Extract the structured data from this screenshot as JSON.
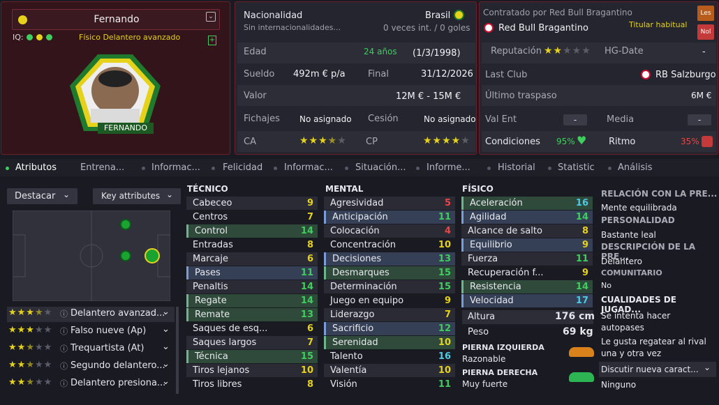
{
  "player": {
    "name": "Fernando",
    "iq_label": "IQ:",
    "role": "Físico  Delantero avanzado",
    "tag": "FERNANDO"
  },
  "info": {
    "nationality_label": "Nacionalidad",
    "nationality": "Brasil",
    "intl_label": "Sin internacionalidades...",
    "intl_value": "0 veces int. / 0 goles",
    "age_label": "Edad",
    "age": "24 años",
    "dob": "(1/3/1998)",
    "wage_label": "Sueldo",
    "wage": "492m € p/a",
    "end_label": "Final",
    "end": "31/12/2026",
    "value_label": "Valor",
    "value": "12M € - 15M €",
    "transfers_label": "Fichajes",
    "transfers": "No asignado",
    "loan_label": "Cesión",
    "loan": "No asignado",
    "ca_label": "CA",
    "cp_label": "CP",
    "ca_stars": 3.5,
    "cp_stars": 4
  },
  "club": {
    "contract_label": "Contratado por Red Bull Bragantino",
    "club_name": "Red Bull Bragantino",
    "status": "Titular habitual",
    "les": "Les",
    "nol": "Nol",
    "reputation_label": "Reputación",
    "reputation_stars": 2,
    "hg_label": "HG-Date",
    "hg_value": "-",
    "last_club_label": "Last Club",
    "last_club": "RB Salzburgo",
    "last_transfer_label": "Último traspaso",
    "last_transfer": "6M €",
    "val_ent_label": "Val Ent",
    "val_ent": "-",
    "media_label": "Media",
    "media": "-",
    "cond_label": "Condiciones",
    "cond": "95%",
    "rhythm_label": "Ritmo",
    "rhythm": "35%"
  },
  "tabs": [
    "Atributos",
    "Entrena...",
    "Informac...",
    "Felicidad",
    "Informac...",
    "Situación...",
    "Informe...",
    "Historial",
    "Statistic",
    "Análisis"
  ],
  "controls": {
    "highlight": "Destacar",
    "key": "Key attributes"
  },
  "technical": {
    "title": "TÉCNICO",
    "rows": [
      {
        "name": "Cabeceo",
        "value": "9",
        "hl": ""
      },
      {
        "name": "Centros",
        "value": "7",
        "hl": ""
      },
      {
        "name": "Control",
        "value": "14",
        "hl": "g"
      },
      {
        "name": "Entradas",
        "value": "8",
        "hl": ""
      },
      {
        "name": "Marcaje",
        "value": "6",
        "hl": ""
      },
      {
        "name": "Pases",
        "value": "11",
        "hl": "b"
      },
      {
        "name": "Penaltis",
        "value": "14",
        "hl": ""
      },
      {
        "name": "Regate",
        "value": "14",
        "hl": "g"
      },
      {
        "name": "Remate",
        "value": "13",
        "hl": "g"
      },
      {
        "name": "Saques de esq...",
        "value": "6",
        "hl": ""
      },
      {
        "name": "Saques largos",
        "value": "7",
        "hl": ""
      },
      {
        "name": "Técnica",
        "value": "15",
        "hl": "g"
      },
      {
        "name": "Tiros lejanos",
        "value": "10",
        "hl": ""
      },
      {
        "name": "Tiros libres",
        "value": "8",
        "hl": ""
      }
    ]
  },
  "mental": {
    "title": "MENTAL",
    "rows": [
      {
        "name": "Agresividad",
        "value": "5",
        "hl": ""
      },
      {
        "name": "Anticipación",
        "value": "11",
        "hl": "b"
      },
      {
        "name": "Colocación",
        "value": "4",
        "hl": ""
      },
      {
        "name": "Concentración",
        "value": "10",
        "hl": ""
      },
      {
        "name": "Decisiones",
        "value": "13",
        "hl": "b"
      },
      {
        "name": "Desmarques",
        "value": "15",
        "hl": "g"
      },
      {
        "name": "Determinación",
        "value": "15",
        "hl": ""
      },
      {
        "name": "Juego en equipo",
        "value": "9",
        "hl": ""
      },
      {
        "name": "Liderazgo",
        "value": "7",
        "hl": ""
      },
      {
        "name": "Sacrificio",
        "value": "12",
        "hl": "b"
      },
      {
        "name": "Serenidad",
        "value": "10",
        "hl": "g"
      },
      {
        "name": "Talento",
        "value": "16",
        "hl": ""
      },
      {
        "name": "Valentía",
        "value": "10",
        "hl": ""
      },
      {
        "name": "Visión",
        "value": "11",
        "hl": ""
      }
    ]
  },
  "physical": {
    "title": "FÍSICO",
    "rows": [
      {
        "name": "Aceleración",
        "value": "16",
        "hl": "g"
      },
      {
        "name": "Agilidad",
        "value": "14",
        "hl": "b"
      },
      {
        "name": "Alcance de salto",
        "value": "8",
        "hl": ""
      },
      {
        "name": "Equilibrio",
        "value": "9",
        "hl": "b"
      },
      {
        "name": "Fuerza",
        "value": "11",
        "hl": ""
      },
      {
        "name": "Recuperación f...",
        "value": "9",
        "hl": ""
      },
      {
        "name": "Resistencia",
        "value": "14",
        "hl": "g"
      },
      {
        "name": "Velocidad",
        "value": "17",
        "hl": "b"
      }
    ],
    "height_label": "Altura",
    "height": "176 cm",
    "weight_label": "Peso",
    "weight": "69 kg",
    "left_foot_label": "PIERNA IZQUIERDA",
    "left_foot": "Razonable",
    "right_foot_label": "PIERNA DERECHA",
    "right_foot": "Muy fuerte"
  },
  "side": {
    "h1": "RELACIÓN CON LA PRE...",
    "t1": "Mente equilibrada",
    "h2": "PERSONALIDAD",
    "t2": "Bastante leal",
    "h3": "DESCRIPCIÓN DE LA PRE...",
    "t3": "Delantero",
    "h4": "COMUNITARIO",
    "t4": "No",
    "h5": "CUALIDADES DE JUGAD...",
    "t5a": "Se intenta hacer",
    "t5b": "autopases",
    "t6a": "Le gusta regatear al rival",
    "t6b": "una y otra vez",
    "t7": "Discutir nueva caract...",
    "t8": "Ninguno"
  },
  "roles": [
    {
      "name": "Delantero avanzad...",
      "stars": 3.5
    },
    {
      "name": "Falso nueve (Ap)",
      "stars": 3
    },
    {
      "name": "Trequartista (At)",
      "stars": 2.5
    },
    {
      "name": "Segundo delantero...",
      "stars": 2.5
    },
    {
      "name": "Delantero presiona...",
      "stars": 2.5
    }
  ]
}
